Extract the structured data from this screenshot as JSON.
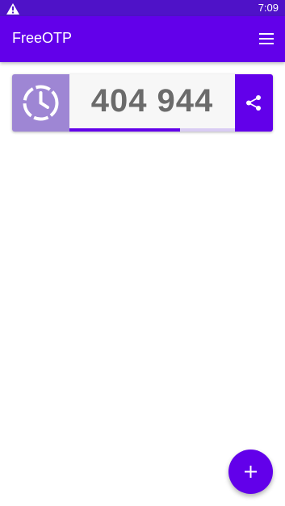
{
  "status_bar": {
    "time": "7:09",
    "warning_icon": "warning-icon",
    "background": "#4f12c8"
  },
  "app_bar": {
    "title": "FreeOTP",
    "menu_icon": "menu-icon",
    "background": "#6200ea"
  },
  "tokens": [
    {
      "code": "404 944",
      "image_icon": "clock-icon",
      "share_icon": "share-icon",
      "progress": 0.67
    }
  ],
  "fab": {
    "icon": "add-icon"
  },
  "colors": {
    "accent": "#6200ea",
    "token_image_bg": "#9e86d4",
    "progress_track": "#d9ccf3",
    "code_text": "#6b6b6b"
  }
}
